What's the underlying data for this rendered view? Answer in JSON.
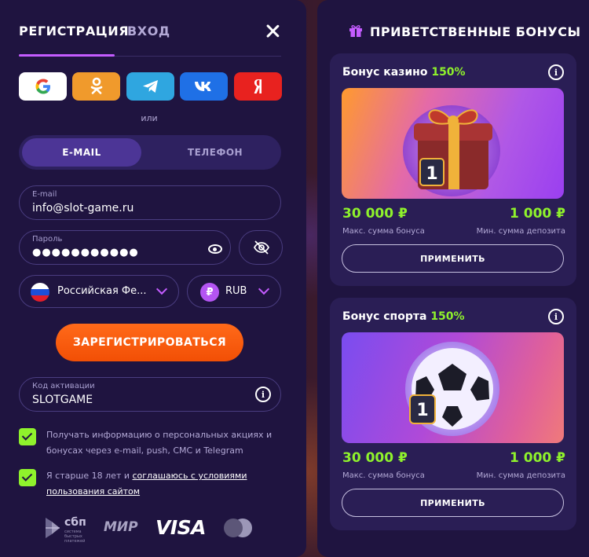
{
  "auth": {
    "tab_register": "РЕГИСТРАЦИЯ",
    "tab_login": "ВХОД",
    "or_label": "или",
    "socials": [
      "google-icon",
      "odnoklassniki-icon",
      "telegram-icon",
      "vk-icon",
      "yandex-icon"
    ],
    "method_email": "E-MAIL",
    "method_phone": "ТЕЛЕФОН",
    "email_label": "E-mail",
    "email_value": "info@slot-game.ru",
    "password_label": "Пароль",
    "password_value": "●●●●●●●●●●●",
    "country_value": "Российская Фе...",
    "currency_symbol": "₽",
    "currency_value": "RUB",
    "register_button": "ЗАРЕГИСТРИРОВАТЬСЯ",
    "promo_label": "Код активации",
    "promo_value": "SLOTGAME",
    "consent_marketing": "Получать информацию о персональных акциях и бонусах через e-mail, push, СМС и Telegram",
    "consent_age_prefix": "Я старше 18 лет и ",
    "consent_age_link": "соглашаюсь с условиями пользования сайтом",
    "payments": {
      "sbp": "сбп",
      "sbp_sub": "система быстрых платежей",
      "mir": "МИР",
      "visa": "VISA"
    }
  },
  "bonuses": {
    "title": "ПРИВЕТСТВЕННЫЕ БОНУСЫ",
    "cards": [
      {
        "title": "Бонус казино ",
        "percent": "150%",
        "max_amount": "30 000 ₽",
        "max_label": "Макс. сумма бонуса",
        "min_amount": "1 000 ₽",
        "min_label": "Мин. сумма депозита",
        "button": "ПРИМЕНИТЬ"
      },
      {
        "title": "Бонус спорта ",
        "percent": "150%",
        "max_amount": "30 000 ₽",
        "max_label": "Макс. сумма бонуса",
        "min_amount": "1 000 ₽",
        "min_label": "Мин. сумма депозита",
        "button": "ПРИМЕНИТЬ"
      }
    ]
  },
  "colors": {
    "panel": "#1f1440",
    "accent_purple": "#c45cff",
    "accent_green": "#8ff22c",
    "accent_orange": "#f24f05"
  }
}
